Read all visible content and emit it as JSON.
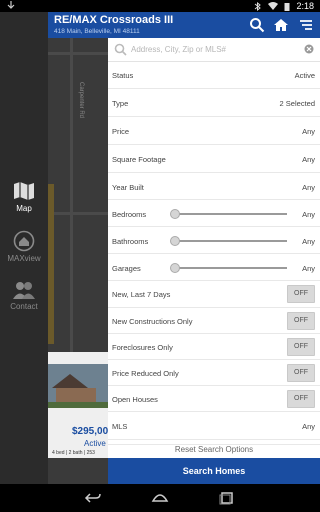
{
  "statusbar": {
    "time": "2:18"
  },
  "header": {
    "brand": "RE/MAX Crossroads III",
    "address": "418 Main, Belleville, MI 48111"
  },
  "rail": {
    "items": [
      {
        "label": "Map",
        "icon": "map-icon",
        "active": true
      },
      {
        "label": "MAXview",
        "icon": "maxview-icon",
        "active": false
      },
      {
        "label": "Contact",
        "icon": "contact-icon",
        "active": false
      }
    ]
  },
  "map": {
    "street_label": "Carpenter Rd"
  },
  "listing_card": {
    "price": "$295,00",
    "status": "Active",
    "details": "4 bed | 2 bath | 253"
  },
  "search": {
    "placeholder": "Address, City, Zip or MLS#"
  },
  "filters": {
    "status": {
      "label": "Status",
      "value": "Active"
    },
    "type": {
      "label": "Type",
      "value": "2 Selected"
    },
    "price": {
      "label": "Price",
      "value": "Any"
    },
    "sqft": {
      "label": "Square Footage",
      "value": "Any"
    },
    "year": {
      "label": "Year Built",
      "value": "Any"
    },
    "bedrooms": {
      "label": "Bedrooms",
      "value": "Any"
    },
    "bathrooms": {
      "label": "Bathrooms",
      "value": "Any"
    },
    "garages": {
      "label": "Garages",
      "value": "Any"
    },
    "new7": {
      "label": "New, Last 7 Days",
      "toggle": "OFF"
    },
    "newcons": {
      "label": "New Constructions Only",
      "toggle": "OFF"
    },
    "foreclosures": {
      "label": "Foreclosures Only",
      "toggle": "OFF"
    },
    "pricereduced": {
      "label": "Price Reduced Only",
      "toggle": "OFF"
    },
    "openhouses": {
      "label": "Open Houses",
      "toggle": "OFF"
    },
    "mls": {
      "label": "MLS",
      "value": "Any"
    }
  },
  "reset_label": "Reset Search Options",
  "search_button": "Search Homes",
  "colors": {
    "brand_blue": "#1a4da1"
  }
}
